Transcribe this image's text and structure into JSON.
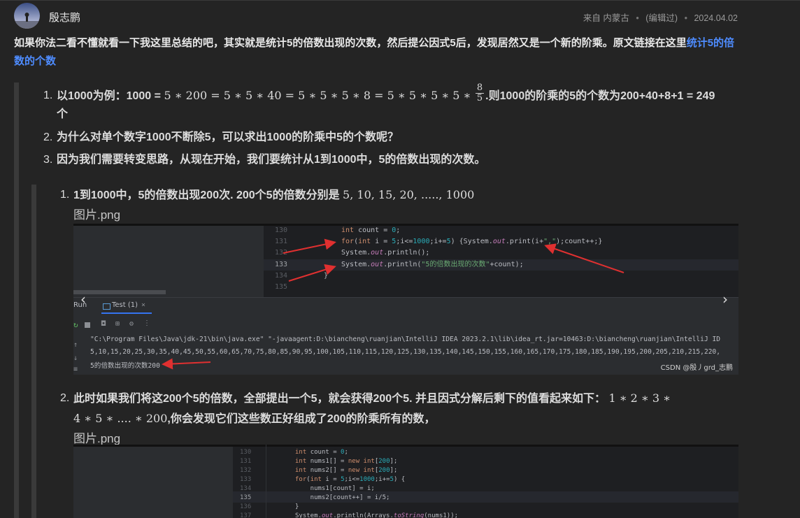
{
  "header": {
    "author": "殷志鹏",
    "from": "来自 内蒙古",
    "edited": "(编辑过)",
    "date": "2024.04.02"
  },
  "intro": {
    "text": "如果你法二看不懂就看一下我这里总结的吧，其实就是统计5的倍数出现的次数，然后提公因式5后，发现居然又是一个新的阶乘。原文链接在这里",
    "link": "统计5的倍数的个数"
  },
  "list1": {
    "items": [
      {
        "num": "1.",
        "prefix": "以1000为例：1000 =",
        "math": "5 ∗ 200 = 5 ∗ 5 ∗ 40 = 5 ∗ 5 ∗ 5 ∗ 8 = 5 ∗ 5 ∗ 5 ∗ 5 ∗",
        "frac_n": "8",
        "frac_d": "5",
        "suffix": ".则1000的阶乘的5的个数为200+40+8+1 = 249",
        "tail": "个"
      },
      {
        "num": "2.",
        "text": "为什么对单个数字1000不断除5，可以求出1000的阶乘中5的个数呢？"
      },
      {
        "num": "3.",
        "text": "因为我们需要转变思路，从现在开始，我们要统计从1到1000中，5的倍数出现的次数。"
      }
    ]
  },
  "list2": {
    "items": [
      {
        "num": "1.",
        "text": "1到1000中，5的倍数出现200次. 200个5的倍数分别是",
        "math": "5, 10, 15, 20, ....., 1000",
        "caption": "图片.png"
      },
      {
        "num": "2.",
        "text": "此时如果我们将这200个5的倍数，全部提出一个5，就会获得200个5. 并且因式分解后剩下的值看起来如下：",
        "math1": "1 ∗ 2 ∗ 3 ∗",
        "math2": "4 ∗ 5 ∗ .... ∗ 200",
        "text2": ",你会发现它们这些数正好组成了200的阶乘所有的数，",
        "caption": "图片.png"
      }
    ]
  },
  "screenshot1": {
    "lines": [
      {
        "n": "130",
        "code": "int count = 0;"
      },
      {
        "n": "131",
        "code": "for(int i = 5;i<=1000;i+=5) {System.out.print(i+\",\");count++;}"
      },
      {
        "n": "132",
        "code": "System.out.println();"
      },
      {
        "n": "133",
        "code": "System.out.println(\"5的倍数出现的次数\"+count);"
      },
      {
        "n": "134",
        "code": "}"
      },
      {
        "n": "135",
        "code": ""
      }
    ],
    "run_label": "Run",
    "tab_label": "Test (1)",
    "tab_close": "×",
    "console_cmd": "\"C:\\Program Files\\Java\\jdk-21\\bin\\java.exe\" \"-javaagent:D:\\biancheng\\ruanjian\\IntelliJ IDEA 2023.2.1\\lib\\idea_rt.jar=10463:D:\\biancheng\\ruanjian\\IntelliJ ID",
    "console_out": "5,10,15,20,25,30,35,40,45,50,55,60,65,70,75,80,85,90,95,100,105,110,115,120,125,130,135,140,145,150,155,160,165,170,175,180,185,190,195,200,205,210,215,220,",
    "console_result": "5的倍数出现的次数200",
    "watermark": "CSDN @殷丿grd_志鹏"
  },
  "screenshot2": {
    "lines": [
      {
        "n": "130",
        "code": "int count = 0;"
      },
      {
        "n": "131",
        "code": "int nums1[] = new int[200];"
      },
      {
        "n": "132",
        "code": "int nums2[] = new int[200];"
      },
      {
        "n": "133",
        "code": "for(int i = 5;i<=1000;i+=5) {"
      },
      {
        "n": "134",
        "code": "    nums1[count] = i;"
      },
      {
        "n": "135",
        "code": "    nums2[count++] = i/5;"
      },
      {
        "n": "136",
        "code": "}"
      },
      {
        "n": "137",
        "code": "System.out.println(Arrays.toString(nums1));"
      }
    ]
  },
  "colors": {
    "accent_link": "#4e8cff",
    "arrow": "#e03030",
    "background": "#242424"
  }
}
